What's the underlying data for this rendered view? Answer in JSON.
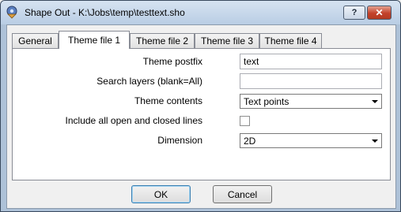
{
  "window": {
    "title": "Shape Out - K:\\Jobs\\temp\\testtext.sho",
    "help_label": "?",
    "close_label": "✕"
  },
  "tabs": [
    {
      "label": "General",
      "active": false
    },
    {
      "label": "Theme file 1",
      "active": true
    },
    {
      "label": "Theme file 2",
      "active": false
    },
    {
      "label": "Theme file 3",
      "active": false
    },
    {
      "label": "Theme file 4",
      "active": false
    }
  ],
  "form": {
    "theme_postfix": {
      "label": "Theme postfix",
      "value": "text"
    },
    "search_layers": {
      "label": "Search layers (blank=All)",
      "value": ""
    },
    "theme_contents": {
      "label": "Theme contents",
      "value": "Text points"
    },
    "include_lines": {
      "label": "Include all open and closed lines",
      "checked": false
    },
    "dimension": {
      "label": "Dimension",
      "value": "2D"
    }
  },
  "buttons": {
    "ok": "OK",
    "cancel": "Cancel"
  }
}
